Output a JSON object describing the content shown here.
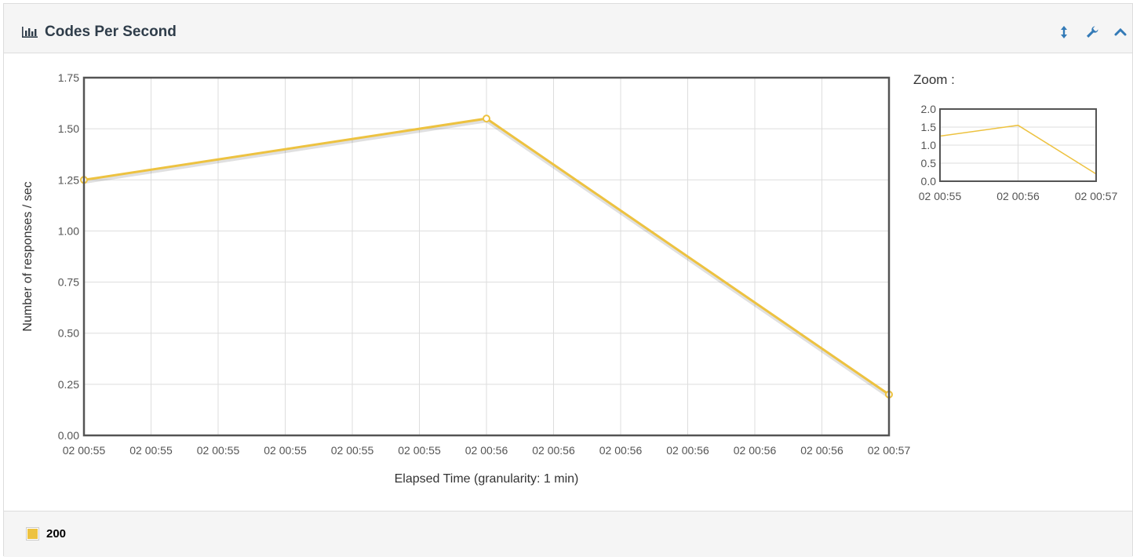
{
  "panel": {
    "title": "Codes Per Second",
    "icons": [
      "bar-chart-icon",
      "resize-vertical-icon",
      "wrench-icon",
      "chevron-up-icon"
    ]
  },
  "colors": {
    "series": "#edc240",
    "axis": "#545454",
    "grid": "#dddddd"
  },
  "chart_data": {
    "type": "line",
    "title": "",
    "xlabel": "Elapsed Time (granularity: 1 min)",
    "ylabel": "Number of responses / sec",
    "ylim": [
      0,
      1.75
    ],
    "yticks": [
      "0.00",
      "0.25",
      "0.50",
      "0.75",
      "1.00",
      "1.25",
      "1.50",
      "1.75"
    ],
    "xticks": [
      "02 00:55",
      "02 00:55",
      "02 00:55",
      "02 00:55",
      "02 00:55",
      "02 00:55",
      "02 00:56",
      "02 00:56",
      "02 00:56",
      "02 00:56",
      "02 00:56",
      "02 00:56",
      "02 00:57"
    ],
    "grid": true,
    "legend": "bottom",
    "series": [
      {
        "name": "200",
        "points": [
          {
            "x": "02 00:55",
            "y": 1.25
          },
          {
            "x": "02 00:56",
            "y": 1.55
          },
          {
            "x": "02 00:57",
            "y": 0.2
          }
        ]
      }
    ]
  },
  "zoom": {
    "title": "Zoom :",
    "ylim": [
      0,
      2.0
    ],
    "yticks": [
      "0.0",
      "0.5",
      "1.0",
      "1.5",
      "2.0"
    ],
    "xticks": [
      "02 00:55",
      "02 00:56",
      "02 00:57"
    ]
  },
  "legend": {
    "label": "200"
  }
}
